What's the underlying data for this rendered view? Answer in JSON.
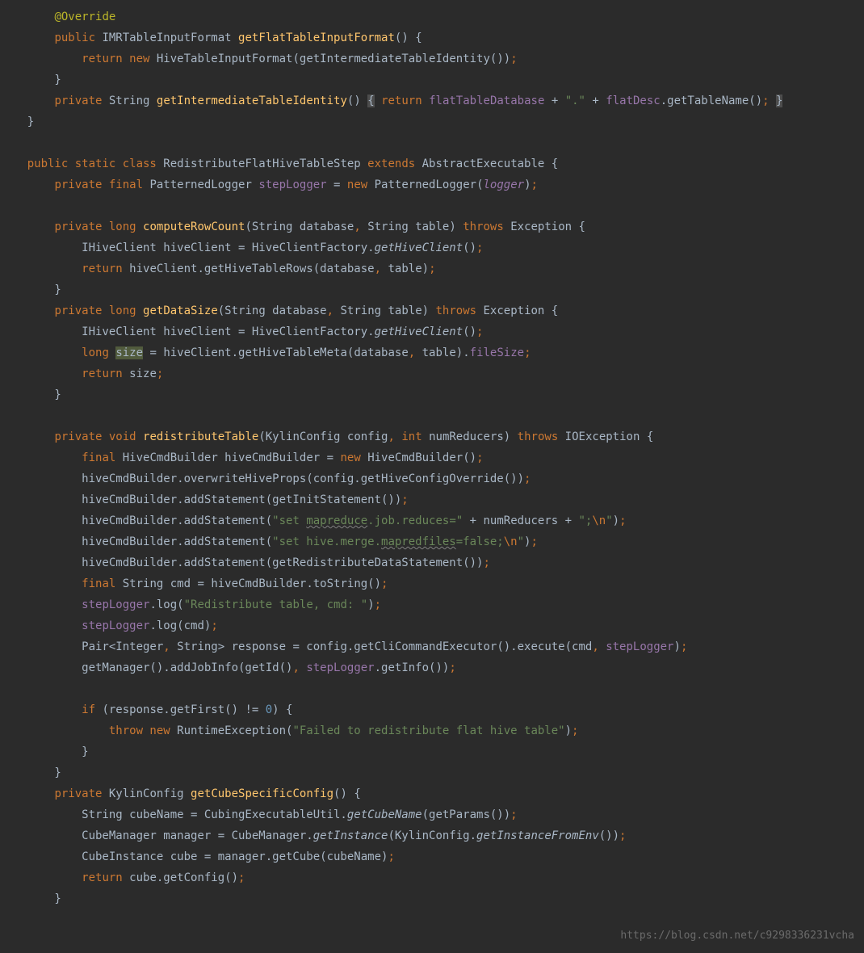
{
  "watermark": "https://blog.csdn.net/c9298336231vcha",
  "code": {
    "lines": [
      [
        {
          "t": "        ",
          "c": ""
        },
        {
          "t": "@Override",
          "c": "ann"
        }
      ],
      [
        {
          "t": "        ",
          "c": ""
        },
        {
          "t": "public",
          "c": "kw"
        },
        {
          "t": " IMRTableInputFormat ",
          "c": ""
        },
        {
          "t": "getFlatTableInputFormat",
          "c": "mname"
        },
        {
          "t": "() {",
          "c": ""
        }
      ],
      [
        {
          "t": "            ",
          "c": ""
        },
        {
          "t": "return new",
          "c": "kw"
        },
        {
          "t": " HiveTableInputFormat(getIntermediateTableIdentity())",
          "c": ""
        },
        {
          "t": ";",
          "c": "kw"
        }
      ],
      [
        {
          "t": "        }",
          "c": ""
        }
      ],
      [
        {
          "t": "        ",
          "c": ""
        },
        {
          "t": "private",
          "c": "kw"
        },
        {
          "t": " String ",
          "c": ""
        },
        {
          "t": "getIntermediateTableIdentity",
          "c": "mname"
        },
        {
          "t": "() ",
          "c": ""
        },
        {
          "t": "{",
          "c": "hl"
        },
        {
          "t": " ",
          "c": ""
        },
        {
          "t": "return",
          "c": "kw"
        },
        {
          "t": " ",
          "c": ""
        },
        {
          "t": "flatTableDatabase",
          "c": "field"
        },
        {
          "t": " + ",
          "c": ""
        },
        {
          "t": "\".\"",
          "c": "str"
        },
        {
          "t": " + ",
          "c": ""
        },
        {
          "t": "flatDesc",
          "c": "field"
        },
        {
          "t": ".getTableName()",
          "c": ""
        },
        {
          "t": ";",
          "c": "kw"
        },
        {
          "t": " ",
          "c": ""
        },
        {
          "t": "}",
          "c": "hl"
        }
      ],
      [
        {
          "t": "    }",
          "c": ""
        }
      ],
      [
        {
          "t": "",
          "c": ""
        }
      ],
      [
        {
          "t": "    ",
          "c": ""
        },
        {
          "t": "public static class",
          "c": "kw"
        },
        {
          "t": " RedistributeFlatHiveTableStep ",
          "c": ""
        },
        {
          "t": "extends",
          "c": "kw"
        },
        {
          "t": " AbstractExecutable {",
          "c": ""
        }
      ],
      [
        {
          "t": "        ",
          "c": ""
        },
        {
          "t": "private final",
          "c": "kw"
        },
        {
          "t": " PatternedLogger ",
          "c": ""
        },
        {
          "t": "stepLogger",
          "c": "field"
        },
        {
          "t": " = ",
          "c": ""
        },
        {
          "t": "new",
          "c": "kw"
        },
        {
          "t": " PatternedLogger(",
          "c": ""
        },
        {
          "t": "logger",
          "c": "field italic"
        },
        {
          "t": ")",
          "c": ""
        },
        {
          "t": ";",
          "c": "kw"
        }
      ],
      [
        {
          "t": "",
          "c": ""
        }
      ],
      [
        {
          "t": "        ",
          "c": ""
        },
        {
          "t": "private long",
          "c": "kw"
        },
        {
          "t": " ",
          "c": ""
        },
        {
          "t": "computeRowCount",
          "c": "mname"
        },
        {
          "t": "(String database",
          "c": ""
        },
        {
          "t": ",",
          "c": "kw"
        },
        {
          "t": " String table) ",
          "c": ""
        },
        {
          "t": "throws",
          "c": "kw"
        },
        {
          "t": " Exception {",
          "c": ""
        }
      ],
      [
        {
          "t": "            IHiveClient hiveClient = HiveClientFactory.",
          "c": ""
        },
        {
          "t": "getHiveClient",
          "c": "italic"
        },
        {
          "t": "()",
          "c": ""
        },
        {
          "t": ";",
          "c": "kw"
        }
      ],
      [
        {
          "t": "            ",
          "c": ""
        },
        {
          "t": "return",
          "c": "kw"
        },
        {
          "t": " hiveClient.getHiveTableRows(database",
          "c": ""
        },
        {
          "t": ",",
          "c": "kw"
        },
        {
          "t": " table)",
          "c": ""
        },
        {
          "t": ";",
          "c": "kw"
        }
      ],
      [
        {
          "t": "        }",
          "c": ""
        }
      ],
      [
        {
          "t": "        ",
          "c": ""
        },
        {
          "t": "private long",
          "c": "kw"
        },
        {
          "t": " ",
          "c": ""
        },
        {
          "t": "getDataSize",
          "c": "mname"
        },
        {
          "t": "(String database",
          "c": ""
        },
        {
          "t": ",",
          "c": "kw"
        },
        {
          "t": " String table) ",
          "c": ""
        },
        {
          "t": "throws",
          "c": "kw"
        },
        {
          "t": " Exception {",
          "c": ""
        }
      ],
      [
        {
          "t": "            IHiveClient hiveClient = HiveClientFactory.",
          "c": ""
        },
        {
          "t": "getHiveClient",
          "c": "italic"
        },
        {
          "t": "()",
          "c": ""
        },
        {
          "t": ";",
          "c": "kw"
        }
      ],
      [
        {
          "t": "            ",
          "c": ""
        },
        {
          "t": "long",
          "c": "kw"
        },
        {
          "t": " ",
          "c": ""
        },
        {
          "t": "size",
          "c": "hlbox"
        },
        {
          "t": " = hiveClient.getHiveTableMeta(database",
          "c": ""
        },
        {
          "t": ",",
          "c": "kw"
        },
        {
          "t": " table).",
          "c": ""
        },
        {
          "t": "fileSize",
          "c": "field"
        },
        {
          "t": ";",
          "c": "kw"
        }
      ],
      [
        {
          "t": "            ",
          "c": ""
        },
        {
          "t": "return",
          "c": "kw"
        },
        {
          "t": " size",
          "c": ""
        },
        {
          "t": ";",
          "c": "kw"
        }
      ],
      [
        {
          "t": "        }",
          "c": ""
        }
      ],
      [
        {
          "t": "",
          "c": ""
        }
      ],
      [
        {
          "t": "        ",
          "c": ""
        },
        {
          "t": "private void",
          "c": "kw"
        },
        {
          "t": " ",
          "c": ""
        },
        {
          "t": "redistributeTable",
          "c": "mname"
        },
        {
          "t": "(KylinConfig config",
          "c": ""
        },
        {
          "t": ",",
          "c": "kw"
        },
        {
          "t": " ",
          "c": ""
        },
        {
          "t": "int",
          "c": "kw"
        },
        {
          "t": " numReducers) ",
          "c": ""
        },
        {
          "t": "throws",
          "c": "kw"
        },
        {
          "t": " IOException {",
          "c": ""
        }
      ],
      [
        {
          "t": "            ",
          "c": ""
        },
        {
          "t": "final",
          "c": "kw"
        },
        {
          "t": " HiveCmdBuilder hiveCmdBuilder = ",
          "c": ""
        },
        {
          "t": "new",
          "c": "kw"
        },
        {
          "t": " HiveCmdBuilder()",
          "c": ""
        },
        {
          "t": ";",
          "c": "kw"
        }
      ],
      [
        {
          "t": "            hiveCmdBuilder.overwriteHiveProps(config.getHiveConfigOverride())",
          "c": ""
        },
        {
          "t": ";",
          "c": "kw"
        }
      ],
      [
        {
          "t": "            hiveCmdBuilder.addStatement(getInitStatement())",
          "c": ""
        },
        {
          "t": ";",
          "c": "kw"
        }
      ],
      [
        {
          "t": "            hiveCmdBuilder.addStatement(",
          "c": ""
        },
        {
          "t": "\"set ",
          "c": "str"
        },
        {
          "t": "mapreduce",
          "c": "str wavy"
        },
        {
          "t": ".job.reduces=\"",
          "c": "str"
        },
        {
          "t": " + numReducers + ",
          "c": ""
        },
        {
          "t": "\";",
          "c": "str"
        },
        {
          "t": "\\n",
          "c": "esc"
        },
        {
          "t": "\"",
          "c": "str"
        },
        {
          "t": ")",
          "c": ""
        },
        {
          "t": ";",
          "c": "kw"
        }
      ],
      [
        {
          "t": "            hiveCmdBuilder.addStatement(",
          "c": ""
        },
        {
          "t": "\"set hive.merge.",
          "c": "str"
        },
        {
          "t": "mapredfiles",
          "c": "str wavy"
        },
        {
          "t": "=false;",
          "c": "str"
        },
        {
          "t": "\\n",
          "c": "esc"
        },
        {
          "t": "\"",
          "c": "str"
        },
        {
          "t": ")",
          "c": ""
        },
        {
          "t": ";",
          "c": "kw"
        }
      ],
      [
        {
          "t": "            hiveCmdBuilder.addStatement(getRedistributeDataStatement())",
          "c": ""
        },
        {
          "t": ";",
          "c": "kw"
        }
      ],
      [
        {
          "t": "            ",
          "c": ""
        },
        {
          "t": "final",
          "c": "kw"
        },
        {
          "t": " String cmd = hiveCmdBuilder.toString()",
          "c": ""
        },
        {
          "t": ";",
          "c": "kw"
        }
      ],
      [
        {
          "t": "            ",
          "c": ""
        },
        {
          "t": "stepLogger",
          "c": "field"
        },
        {
          "t": ".log(",
          "c": ""
        },
        {
          "t": "\"Redistribute table, cmd: \"",
          "c": "str"
        },
        {
          "t": ")",
          "c": ""
        },
        {
          "t": ";",
          "c": "kw"
        }
      ],
      [
        {
          "t": "            ",
          "c": ""
        },
        {
          "t": "stepLogger",
          "c": "field"
        },
        {
          "t": ".log(cmd)",
          "c": ""
        },
        {
          "t": ";",
          "c": "kw"
        }
      ],
      [
        {
          "t": "            Pair<Integer",
          "c": ""
        },
        {
          "t": ",",
          "c": "kw"
        },
        {
          "t": " String> response = config.getCliCommandExecutor().execute(cmd",
          "c": ""
        },
        {
          "t": ",",
          "c": "kw"
        },
        {
          "t": " ",
          "c": ""
        },
        {
          "t": "stepLogger",
          "c": "field"
        },
        {
          "t": ")",
          "c": ""
        },
        {
          "t": ";",
          "c": "kw"
        }
      ],
      [
        {
          "t": "            getManager().addJobInfo(getId()",
          "c": ""
        },
        {
          "t": ",",
          "c": "kw"
        },
        {
          "t": " ",
          "c": ""
        },
        {
          "t": "stepLogger",
          "c": "field"
        },
        {
          "t": ".getInfo())",
          "c": ""
        },
        {
          "t": ";",
          "c": "kw"
        }
      ],
      [
        {
          "t": "",
          "c": ""
        }
      ],
      [
        {
          "t": "            ",
          "c": ""
        },
        {
          "t": "if",
          "c": "kw"
        },
        {
          "t": " (response.getFirst() != ",
          "c": ""
        },
        {
          "t": "0",
          "c": "num"
        },
        {
          "t": ") {",
          "c": ""
        }
      ],
      [
        {
          "t": "                ",
          "c": ""
        },
        {
          "t": "throw new",
          "c": "kw"
        },
        {
          "t": " RuntimeException(",
          "c": ""
        },
        {
          "t": "\"Failed to redistribute flat hive table\"",
          "c": "str"
        },
        {
          "t": ")",
          "c": ""
        },
        {
          "t": ";",
          "c": "kw"
        }
      ],
      [
        {
          "t": "            }",
          "c": ""
        }
      ],
      [
        {
          "t": "        }",
          "c": ""
        }
      ],
      [
        {
          "t": "        ",
          "c": ""
        },
        {
          "t": "private",
          "c": "kw"
        },
        {
          "t": " KylinConfig ",
          "c": ""
        },
        {
          "t": "getCubeSpecificConfig",
          "c": "mname"
        },
        {
          "t": "() {",
          "c": ""
        }
      ],
      [
        {
          "t": "            String cubeName = CubingExecutableUtil.",
          "c": ""
        },
        {
          "t": "getCubeName",
          "c": "italic"
        },
        {
          "t": "(getParams())",
          "c": ""
        },
        {
          "t": ";",
          "c": "kw"
        }
      ],
      [
        {
          "t": "            CubeManager manager = CubeManager.",
          "c": ""
        },
        {
          "t": "getInstance",
          "c": "italic"
        },
        {
          "t": "(KylinConfig.",
          "c": ""
        },
        {
          "t": "getInstanceFromEnv",
          "c": "italic"
        },
        {
          "t": "())",
          "c": ""
        },
        {
          "t": ";",
          "c": "kw"
        }
      ],
      [
        {
          "t": "            CubeInstance cube = manager.getCube(cubeName)",
          "c": ""
        },
        {
          "t": ";",
          "c": "kw"
        }
      ],
      [
        {
          "t": "            ",
          "c": ""
        },
        {
          "t": "return",
          "c": "kw"
        },
        {
          "t": " cube.getConfig()",
          "c": ""
        },
        {
          "t": ";",
          "c": "kw"
        }
      ],
      [
        {
          "t": "        }",
          "c": ""
        }
      ]
    ]
  }
}
